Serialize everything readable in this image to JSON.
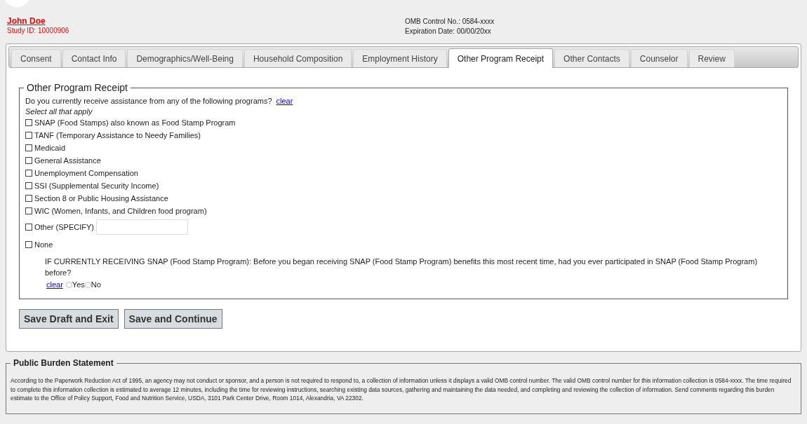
{
  "header": {
    "name": "John Doe",
    "study_id": "Study ID: 10000906",
    "omb_control": "OMB Control No.: 0584-xxxx",
    "expiration": "Expiration Date: 00/00/20xx"
  },
  "tabs": [
    {
      "label": "Consent",
      "selected": false
    },
    {
      "label": "Contact Info",
      "selected": false
    },
    {
      "label": "Demographics/Well-Being",
      "selected": false
    },
    {
      "label": "Household Composition",
      "selected": false
    },
    {
      "label": "Employment History",
      "selected": false
    },
    {
      "label": "Other Program Receipt",
      "selected": true
    },
    {
      "label": "Other Contacts",
      "selected": false
    },
    {
      "label": "Counselor",
      "selected": false
    },
    {
      "label": "Review",
      "selected": false
    }
  ],
  "section": {
    "legend": "Other Program Receipt",
    "question": "Do you currently receive assistance from any of the following programs?",
    "clear_link": "clear",
    "hint": "Select all that apply",
    "options": [
      {
        "label": "SNAP (Food Stamps) also known as Food Stamp Program",
        "checked": false,
        "kind": "plain"
      },
      {
        "label": "TANF (Temporary Assistance to Needy Families)",
        "checked": false,
        "kind": "plain"
      },
      {
        "label": "Medicaid",
        "checked": false,
        "kind": "plain"
      },
      {
        "label": "General Assistance",
        "checked": false,
        "kind": "plain"
      },
      {
        "label": "Unemployment Compensation",
        "checked": false,
        "kind": "plain"
      },
      {
        "label": "SSI (Supplemental Security Income)",
        "checked": false,
        "kind": "plain"
      },
      {
        "label": "Section 8 or Public Housing Assistance",
        "checked": false,
        "kind": "plain"
      },
      {
        "label": "WIC (Women, Infants, and Children food program)",
        "checked": false,
        "kind": "plain"
      },
      {
        "label": "Other (SPECIFY)",
        "checked": false,
        "kind": "specify"
      },
      {
        "label": "None",
        "checked": false,
        "kind": "plain"
      }
    ],
    "followup": {
      "question": "IF CURRENTLY RECEIVING SNAP (Food Stamp Program): Before you began receiving SNAP (Food Stamp Program) benefits this most recent time, had you ever participated in SNAP (Food Stamp Program) before?",
      "clear_link": "clear",
      "choices": [
        {
          "label": "Yes",
          "selected": false
        },
        {
          "label": "No",
          "selected": false
        }
      ]
    }
  },
  "buttons": [
    "Save Draft and Exit",
    "Save and Continue"
  ],
  "burden": {
    "legend": "Public Burden Statement",
    "text": "According to the Paperwork Reduction Act of 1995, an agency may not conduct or sponsor, and a person is not required to respond to, a collection of information unless it displays a valid OMB control number. The valid OMB control number for this information collection is 0584-xxxx. The time required to complete this information collection is estimated to average 12 minutes, including the time for reviewing instructions, searching existing data sources, gathering and maintaining the data needed, and completing and reviewing the collection of information. Send comments regarding this burden estimate to the Office of Policy Support, Food and Nutrition Service, USDA, 3101 Park Center Drive, Room 1014, Alexandria, VA 22302."
  }
}
